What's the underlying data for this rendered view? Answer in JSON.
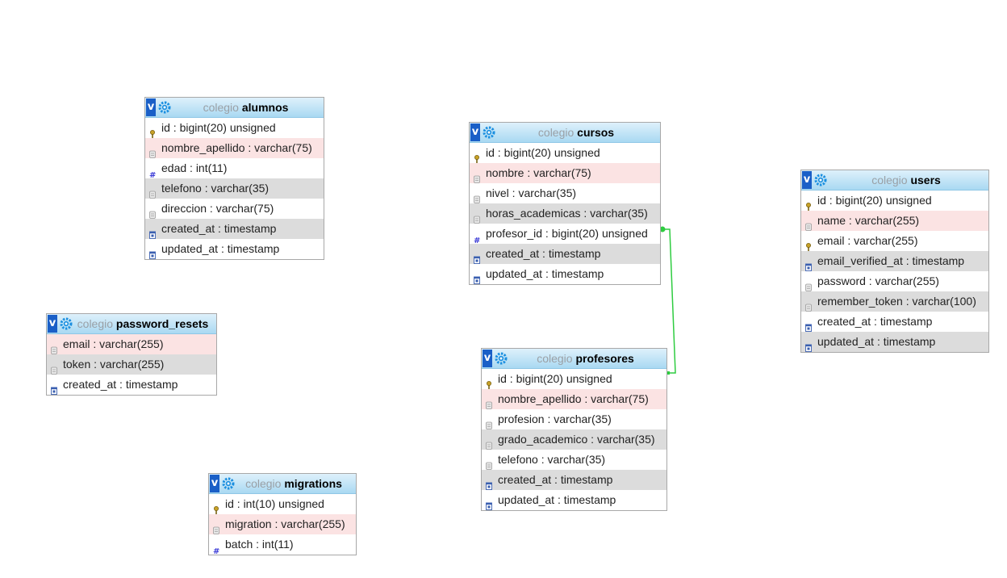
{
  "tables": {
    "alumnos": {
      "db": "colegio",
      "name": "alumnos",
      "fields": [
        {
          "label": "id : bigint(20) unsigned",
          "icon": "key-icon"
        },
        {
          "label": "nombre_apellido : varchar(75)",
          "icon": "text-field-icon"
        },
        {
          "label": "edad : int(11)",
          "icon": "number-field-icon"
        },
        {
          "label": "telefono : varchar(35)",
          "icon": "text-field-icon"
        },
        {
          "label": "direccion : varchar(75)",
          "icon": "text-field-icon"
        },
        {
          "label": "created_at : timestamp",
          "icon": "date-field-icon"
        },
        {
          "label": "updated_at : timestamp",
          "icon": "date-field-icon"
        }
      ]
    },
    "password_resets": {
      "db": "colegio",
      "name": "password_resets",
      "fields": [
        {
          "label": "email : varchar(255)",
          "icon": "text-field-icon"
        },
        {
          "label": "token : varchar(255)",
          "icon": "text-field-icon"
        },
        {
          "label": "created_at : timestamp",
          "icon": "date-field-icon"
        }
      ]
    },
    "migrations": {
      "db": "colegio",
      "name": "migrations",
      "fields": [
        {
          "label": "id : int(10) unsigned",
          "icon": "key-icon"
        },
        {
          "label": "migration : varchar(255)",
          "icon": "text-field-icon"
        },
        {
          "label": "batch : int(11)",
          "icon": "number-field-icon"
        }
      ]
    },
    "cursos": {
      "db": "colegio",
      "name": "cursos",
      "fields": [
        {
          "label": "id : bigint(20) unsigned",
          "icon": "key-icon"
        },
        {
          "label": "nombre : varchar(75)",
          "icon": "text-field-icon"
        },
        {
          "label": "nivel : varchar(35)",
          "icon": "text-field-icon"
        },
        {
          "label": "horas_academicas : varchar(35)",
          "icon": "text-field-icon"
        },
        {
          "label": "profesor_id : bigint(20) unsigned",
          "icon": "number-field-icon"
        },
        {
          "label": "created_at : timestamp",
          "icon": "date-field-icon"
        },
        {
          "label": "updated_at : timestamp",
          "icon": "date-field-icon"
        }
      ]
    },
    "profesores": {
      "db": "colegio",
      "name": "profesores",
      "fields": [
        {
          "label": "id : bigint(20) unsigned",
          "icon": "key-icon"
        },
        {
          "label": "nombre_apellido : varchar(75)",
          "icon": "text-field-icon"
        },
        {
          "label": "profesion : varchar(35)",
          "icon": "text-field-icon"
        },
        {
          "label": "grado_academico : varchar(35)",
          "icon": "text-field-icon"
        },
        {
          "label": "telefono : varchar(35)",
          "icon": "text-field-icon"
        },
        {
          "label": "created_at : timestamp",
          "icon": "date-field-icon"
        },
        {
          "label": "updated_at : timestamp",
          "icon": "date-field-icon"
        }
      ]
    },
    "users": {
      "db": "colegio",
      "name": "users",
      "fields": [
        {
          "label": "id : bigint(20) unsigned",
          "icon": "key-icon"
        },
        {
          "label": "name : varchar(255)",
          "icon": "text-field-icon"
        },
        {
          "label": "email : varchar(255)",
          "icon": "key-icon"
        },
        {
          "label": "email_verified_at : timestamp",
          "icon": "date-field-icon"
        },
        {
          "label": "password : varchar(255)",
          "icon": "text-field-icon"
        },
        {
          "label": "remember_token : varchar(100)",
          "icon": "text-field-icon"
        },
        {
          "label": "created_at : timestamp",
          "icon": "date-field-icon"
        },
        {
          "label": "updated_at : timestamp",
          "icon": "date-field-icon"
        }
      ]
    }
  },
  "toggle_label": "v",
  "relation": {
    "from": "cursos.profesor_id",
    "to": "profesores.id",
    "color": "#2ecc40"
  },
  "colors": {
    "header_top": "#def1fb",
    "header_bottom": "#a9d9f2",
    "row_pink": "#fbe3e3",
    "row_gray": "#dcdcdc",
    "toggle_blue": "#1a5fc7"
  }
}
